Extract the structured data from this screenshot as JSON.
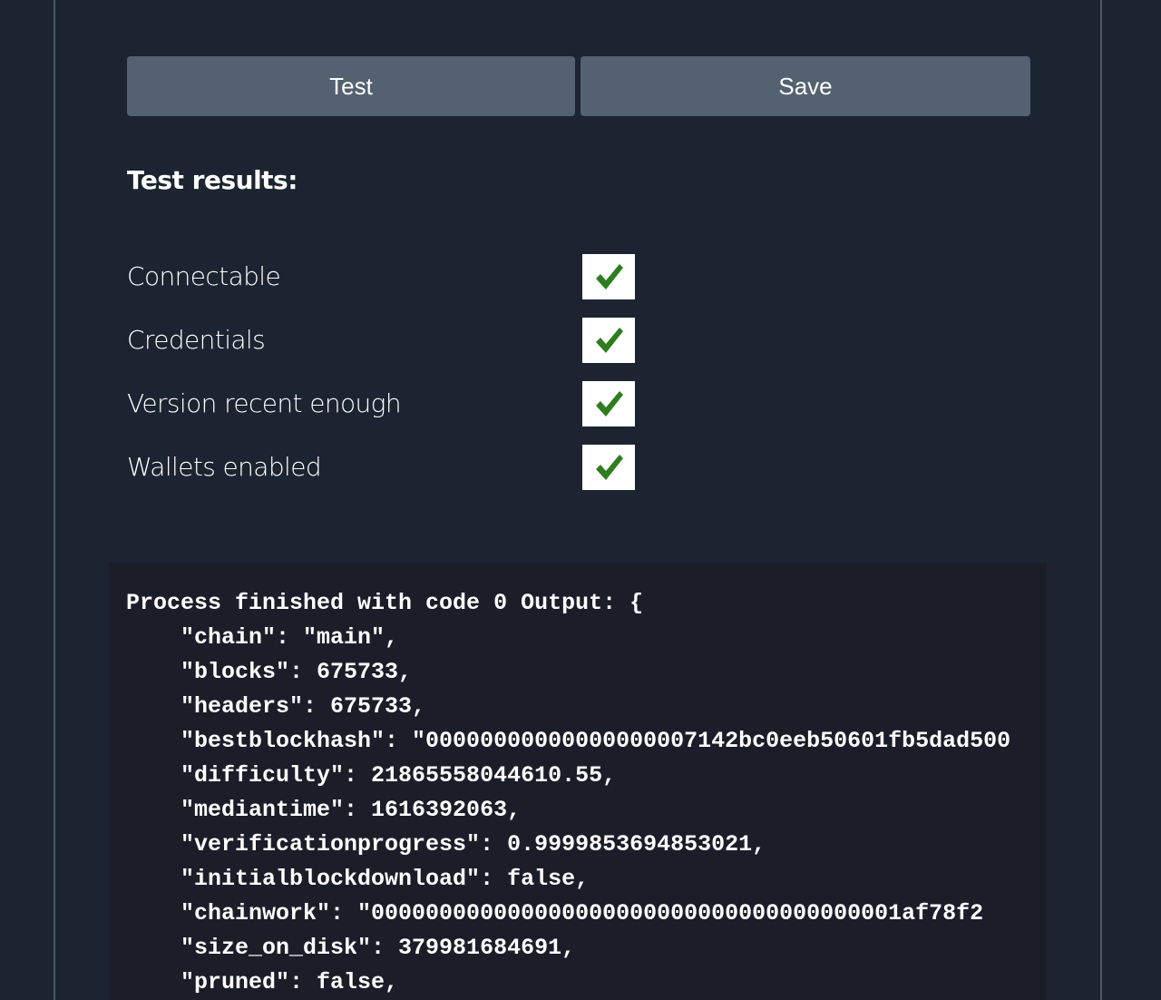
{
  "buttons": {
    "test_label": "Test",
    "save_label": "Save"
  },
  "results": {
    "heading": "Test results:",
    "items": [
      {
        "label": "Connectable",
        "status": "passed",
        "icon": "checkmark-icon"
      },
      {
        "label": "Credentials",
        "status": "passed",
        "icon": "checkmark-icon"
      },
      {
        "label": "Version recent enough",
        "status": "passed",
        "icon": "checkmark-icon"
      },
      {
        "label": "Wallets enabled",
        "status": "passed",
        "icon": "checkmark-icon"
      }
    ]
  },
  "output": {
    "text": "Process finished with code 0 Output: {\n    \"chain\": \"main\",\n    \"blocks\": 675733,\n    \"headers\": 675733,\n    \"bestblockhash\": \"00000000000000000007142bc0eeb50601fb5dad500\n    \"difficulty\": 21865558044610.55,\n    \"mediantime\": 1616392063,\n    \"verificationprogress\": 0.9999853694853021,\n    \"initialblockdownload\": false,\n    \"chainwork\": \"000000000000000000000000000000000000001af78f2\n    \"size_on_disk\": 379981684691,\n    \"pruned\": false,"
  },
  "colors": {
    "background": "#1b2430",
    "button": "#536170",
    "check": "#2e7d1f",
    "output_bg": "#1b1e29"
  }
}
